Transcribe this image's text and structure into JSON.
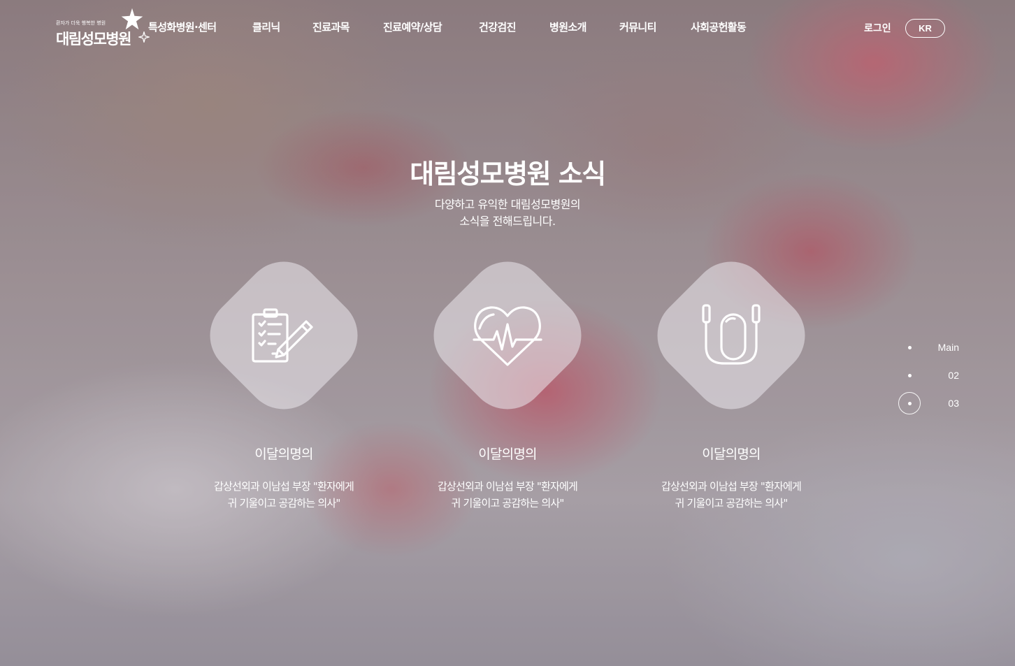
{
  "header": {
    "logo": {
      "tagline": "환자가 더욱 행복한 병원",
      "name": "대림성모병원"
    },
    "nav": [
      "특성화병원·센터",
      "클리닉",
      "진료과목",
      "진료예약/상담",
      "건강검진",
      "병원소개",
      "커뮤니티",
      "사회공헌활동"
    ],
    "login_label": "로그인",
    "lang_label": "KR"
  },
  "section": {
    "title": "대림성모병원 소식",
    "subtitle_line1": "다양하고 유익한 대림성모병원의",
    "subtitle_line2": "소식을 전해드립니다."
  },
  "cards": [
    {
      "icon": "clipboard-pencil-icon",
      "title": "이달의명의",
      "desc_line1": "갑상선외과 이남섭 부장 \"환자에게",
      "desc_line2": "귀 기울이고 공감하는 의사\""
    },
    {
      "icon": "heart-pulse-icon",
      "title": "이달의명의",
      "desc_line1": "갑상선외과 이남섭 부장 \"환자에게",
      "desc_line2": "귀 기울이고 공감하는 의사\""
    },
    {
      "icon": "stethoscope-icon",
      "title": "이달의명의",
      "desc_line1": "갑상선외과 이남섭 부장 \"환자에게",
      "desc_line2": "귀 기울이고 공감하는 의사\""
    }
  ],
  "pager": {
    "items": [
      "Main",
      "02",
      "03"
    ],
    "active_index": 2
  },
  "colors": {
    "text": "#ffffff",
    "accent_pink": "#d76e7d"
  }
}
